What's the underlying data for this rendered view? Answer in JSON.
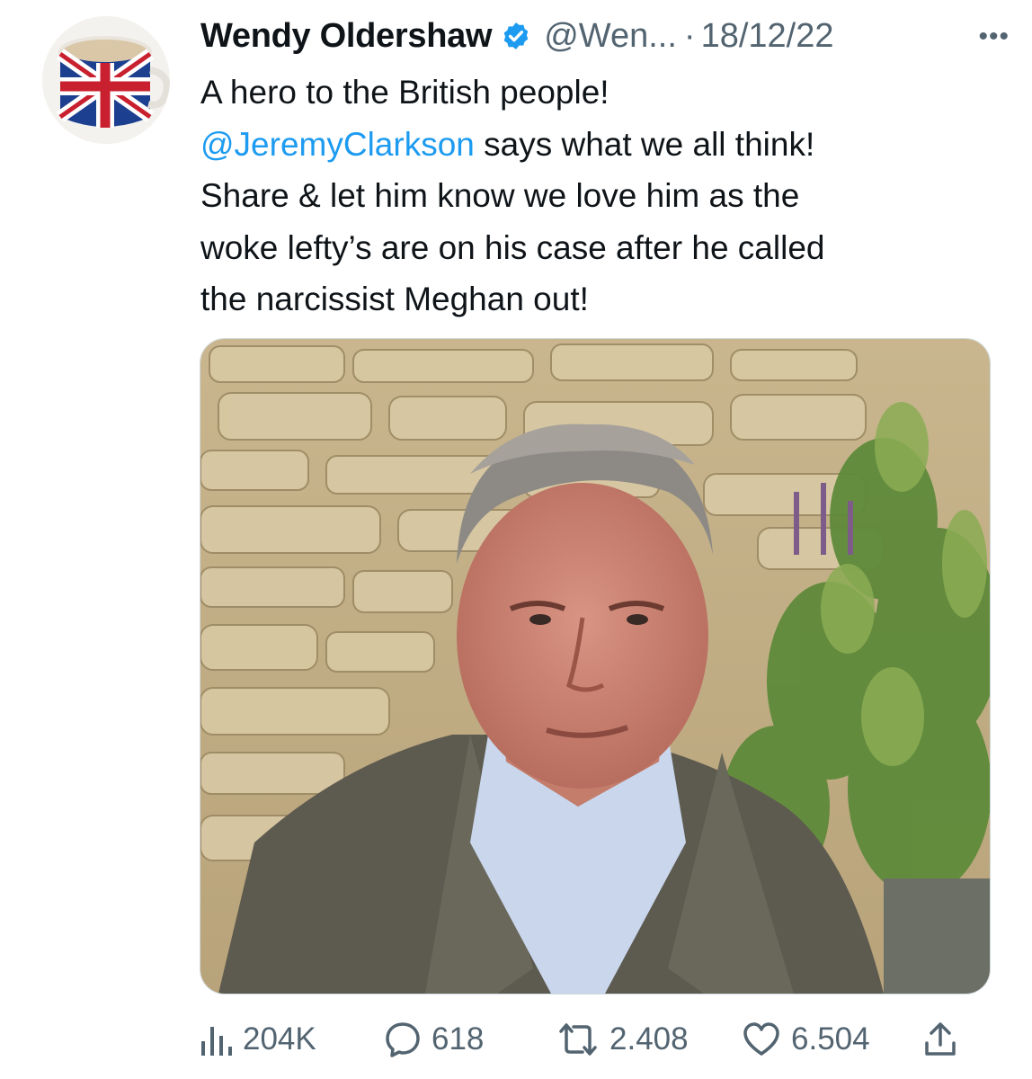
{
  "tweet": {
    "author_name": "Wendy Oldershaw",
    "handle": "@Wen...",
    "separator": "·",
    "date": "18/12/22",
    "more_label": "•••",
    "text_line1": "A hero to the British people!",
    "mention": "@JeremyClarkson",
    "text_line2_rest": " says what we all think!",
    "text_line3": "Share & let him know we love him as the",
    "text_line4": "woke lefty’s are on his case after he called",
    "text_line5": "the narcissist Meghan out!"
  },
  "metrics": {
    "views": "204K",
    "replies": "618",
    "retweets": "2.408",
    "likes": "6.504"
  },
  "colors": {
    "link": "#1d9bf0",
    "secondary_text": "#536471",
    "verified_badge": "#1d9bf0"
  },
  "icons": {
    "verified": "verified-badge-icon",
    "views": "bar-chart-icon",
    "reply": "speech-bubble-icon",
    "retweet": "retweet-arrows-icon",
    "like": "heart-icon",
    "share": "share-upload-icon"
  }
}
